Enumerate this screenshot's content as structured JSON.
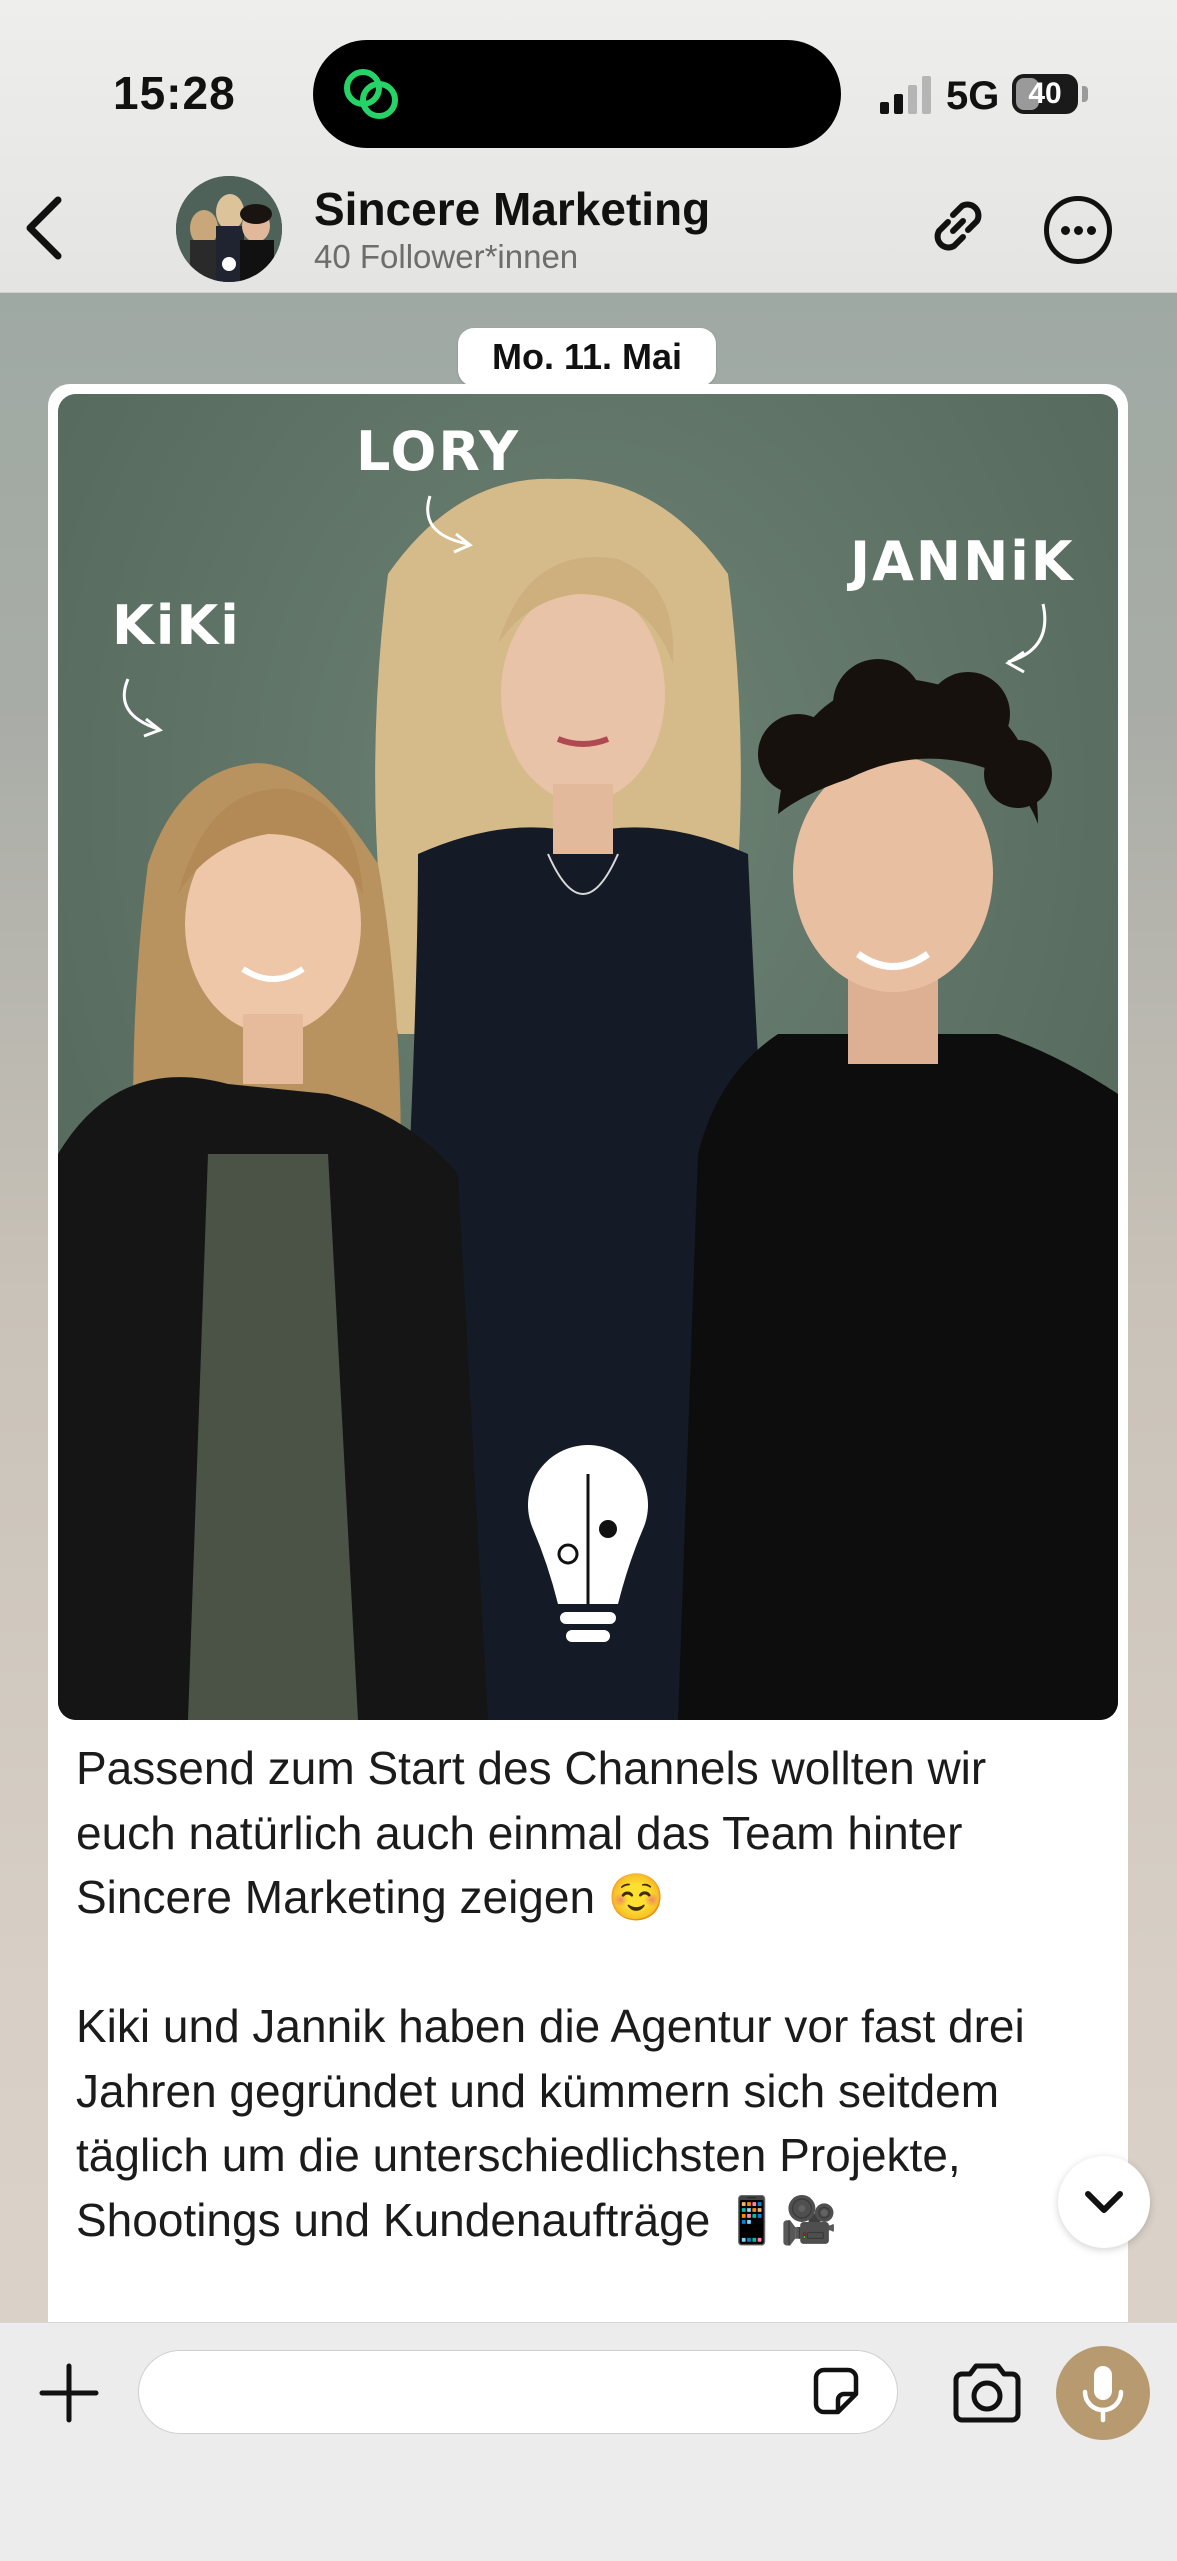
{
  "status_bar": {
    "time": "15:28",
    "network": "5G",
    "battery": "40",
    "battery_level": 0.4
  },
  "header": {
    "channel_name": "Sincere Marketing",
    "followers": "40 Follower*innen",
    "icons": {
      "back": "chevron-left-icon",
      "link": "link-icon",
      "more": "more-options-icon"
    }
  },
  "date_chip": "Mo. 11. Mai",
  "message": {
    "image_labels": {
      "left": "KiKi",
      "center": "LORY",
      "right": "JANNiK"
    },
    "paragraphs": [
      "Passend zum Start des Channels wollten wir euch natürlich auch einmal das Team hinter Sincere Marketing zeigen ☺️",
      "Kiki und Jannik haben die Agentur vor fast drei Jahren gegründet und kümmern sich seitdem täglich um die unterschiedlichsten Projekte, Shootings und Kundenaufträge 📱🎥"
    ]
  },
  "input_bar": {
    "placeholder": "",
    "icons": {
      "plus": "plus-icon",
      "sticker": "sticker-icon",
      "camera": "camera-icon",
      "mic": "microphone-icon"
    }
  },
  "colors": {
    "accent_green": "#25d366",
    "mic_button": "#b79a70",
    "photo_background": "#5b7164"
  }
}
